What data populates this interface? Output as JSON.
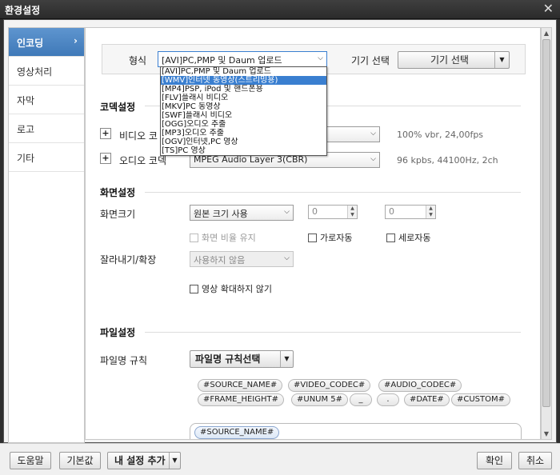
{
  "window": {
    "title": "환경설정",
    "close": "✕"
  },
  "sidebar": {
    "items": [
      {
        "label": "인코딩",
        "active": true
      },
      {
        "label": "영상처리"
      },
      {
        "label": "자막"
      },
      {
        "label": "로고"
      },
      {
        "label": "기타"
      }
    ]
  },
  "format": {
    "label": "형식",
    "value": "[AVI]PC,PMP 및 Daum 업로드",
    "device_label": "기기 선택",
    "device_button": "기기 선택",
    "options": [
      "[AVI]PC,PMP 및 Daum 업로드",
      "[WMV]인터넷 동영상(스트리밍용)",
      "[MP4]PSP, iPod 및 핸드폰용",
      "[FLV]플래시 비디오",
      "[MKV]PC 동영상",
      "[SWF]플래시 비디오",
      "[OGG]오디오 추출",
      "[MP3]오디오 추출",
      "[OGV]인터넷,PC 영상",
      "[TS]PC 영상"
    ],
    "highlighted_index": 1
  },
  "codec": {
    "title": "코덱설정",
    "video_label": "비디오 코",
    "video_info": "100% vbr, 24,00fps",
    "audio_label": "오디오 코덱",
    "audio_value": "MPEG Audio Layer 3(CBR)",
    "audio_info": "96 kpbs, 44100Hz, 2ch"
  },
  "screen": {
    "title": "화면설정",
    "size_label": "화면크기",
    "size_value": "원본 크기 사용",
    "width_value": "0",
    "height_value": "0",
    "keep_ratio": "화면 비율 유지",
    "auto_width": "가로자동",
    "auto_height": "세로자동",
    "crop_label": "잘라내기/확장",
    "crop_value": "사용하지 않음",
    "no_enlarge": "영상 확대하지 않기"
  },
  "file": {
    "title": "파일설정",
    "rule_label": "파일명 규칙",
    "rule_button": "파일명 규칙선택",
    "tags_row1": [
      "#SOURCE_NAME#",
      "#VIDEO_CODEC#",
      "#AUDIO_CODEC#"
    ],
    "tags_row2": [
      "#FRAME_HEIGHT#",
      "#UNUM 5#",
      "_",
      ".",
      "#DATE#",
      "#CUSTOM#"
    ],
    "field_tag": "#SOURCE_NAME#"
  },
  "footer": {
    "help": "도움말",
    "default": "기본값",
    "add_preset": "내 설정 추가",
    "ok": "확인",
    "cancel": "취소"
  }
}
